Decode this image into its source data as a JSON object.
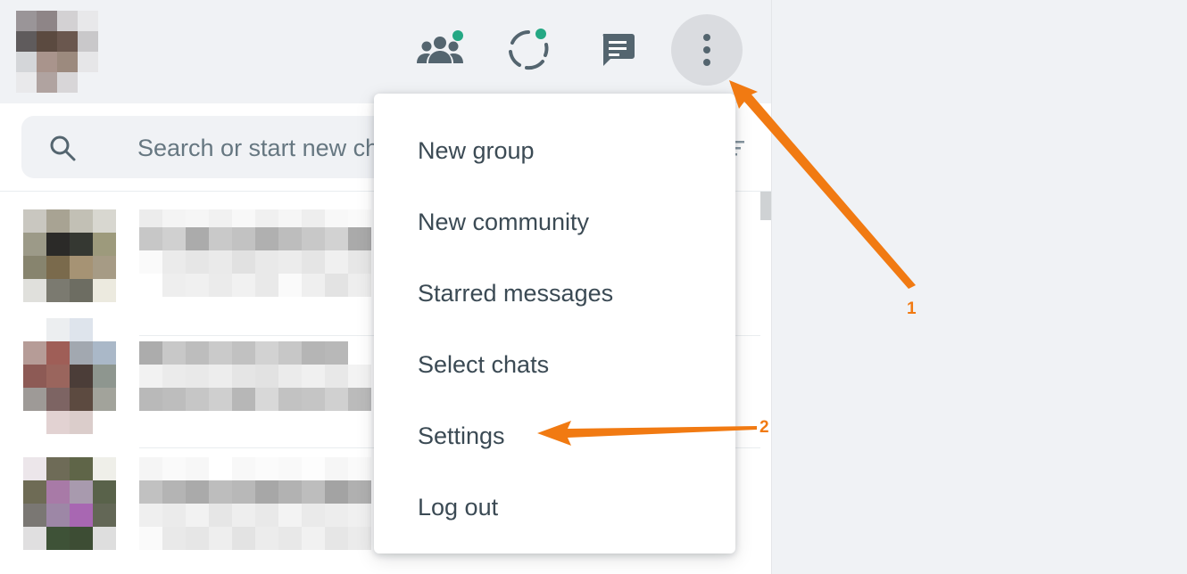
{
  "header": {
    "icons": [
      "communities-icon",
      "status-icon",
      "new-chat-icon",
      "menu-icon"
    ],
    "notification_color": "#25a884"
  },
  "search": {
    "placeholder": "Search or start new chat"
  },
  "menu": {
    "items": [
      {
        "label": "New group"
      },
      {
        "label": "New community"
      },
      {
        "label": "Starred messages"
      },
      {
        "label": "Select chats"
      },
      {
        "label": "Settings"
      },
      {
        "label": "Log out"
      }
    ]
  },
  "annotations": {
    "step_1": "1",
    "step_2": "2",
    "color": "#f17a12"
  }
}
